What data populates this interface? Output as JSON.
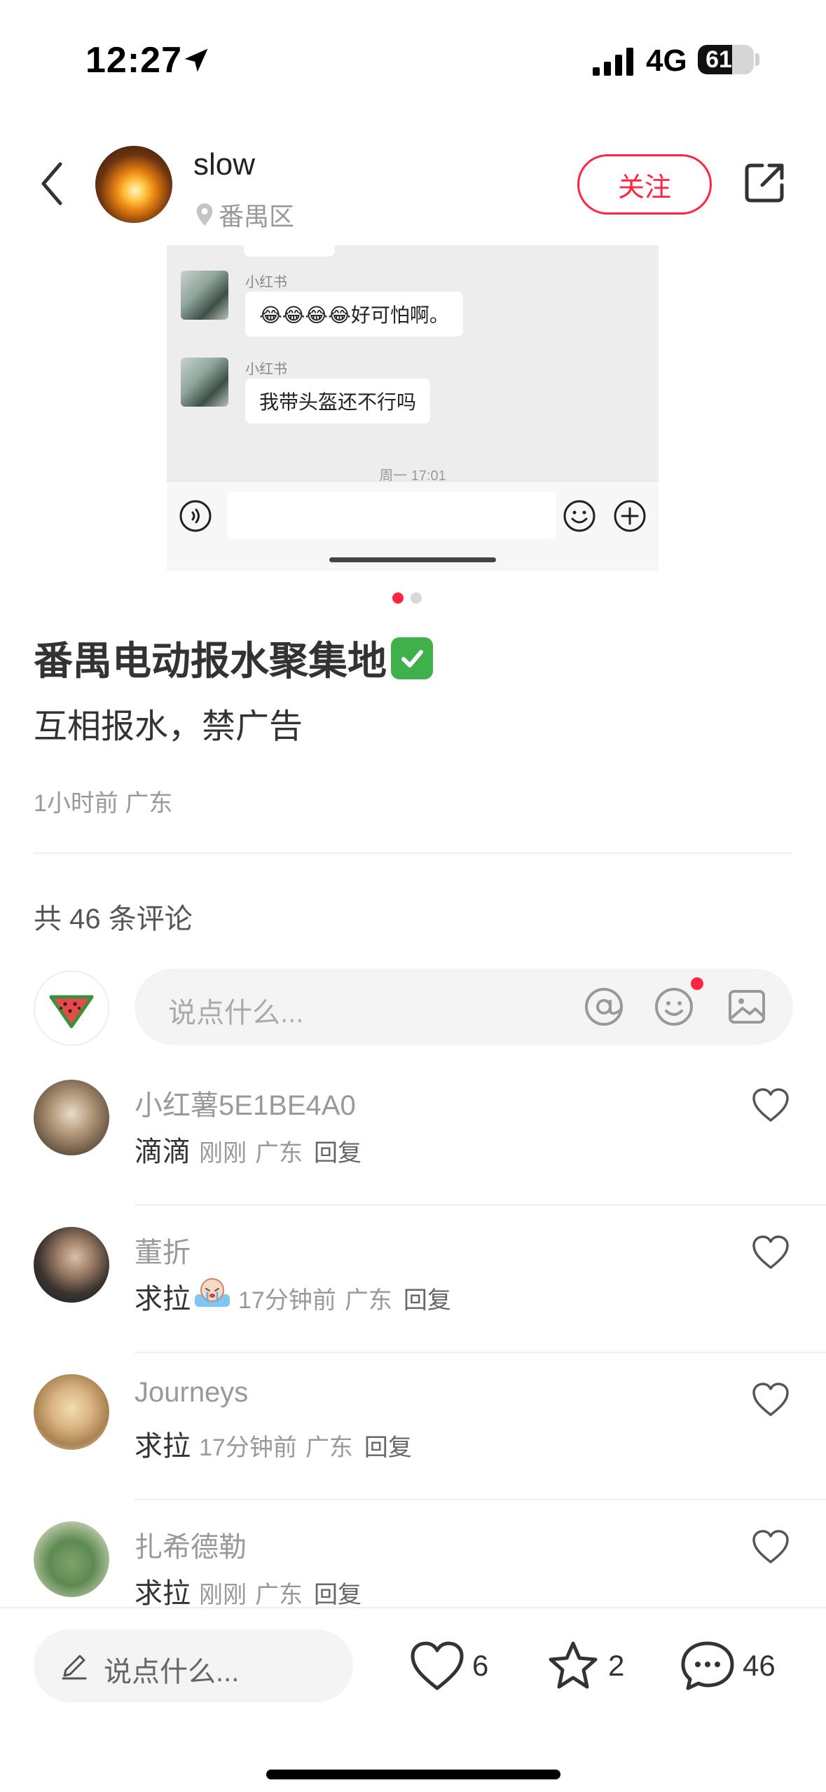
{
  "status_bar": {
    "time": "12:27",
    "network": "4G",
    "battery": "61",
    "battery_level": 0.61
  },
  "header": {
    "user_name": "slow",
    "location": "番禺区",
    "follow_label": "关注"
  },
  "image_card": {
    "messages": [
      {
        "sender": "小红书",
        "text": "😂😂😂😂好可怕啊。"
      },
      {
        "sender": "小红书",
        "text": "我带头盔还不行吗"
      }
    ],
    "time_divider": "周一 17:01"
  },
  "post": {
    "title": "番禺电动报水聚集地",
    "body": "互相报水，禁广告",
    "meta": "1小时前 广东"
  },
  "comments_section": {
    "count_label": "共 46 条评论",
    "input_placeholder": "说点什么...",
    "items": [
      {
        "name": "小红薯5E1BE4A0",
        "text": "滴滴",
        "time": "刚刚",
        "region": "广东",
        "reply": "回复"
      },
      {
        "name": "董折",
        "text": "求拉",
        "time": "17分钟前",
        "region": "广东",
        "reply": "回复"
      },
      {
        "name": "Journeys",
        "text": "求拉",
        "time": "17分钟前",
        "region": "广东",
        "reply": "回复"
      },
      {
        "name": "扎希德勒",
        "text": "求拉",
        "time": "刚刚",
        "region": "广东",
        "reply": "回复"
      }
    ]
  },
  "bottom_bar": {
    "input_placeholder": "说点什么...",
    "likes": "6",
    "collects": "2",
    "comments": "46"
  },
  "colors": {
    "accent": "#ff2442",
    "check": "#3fb04a"
  }
}
